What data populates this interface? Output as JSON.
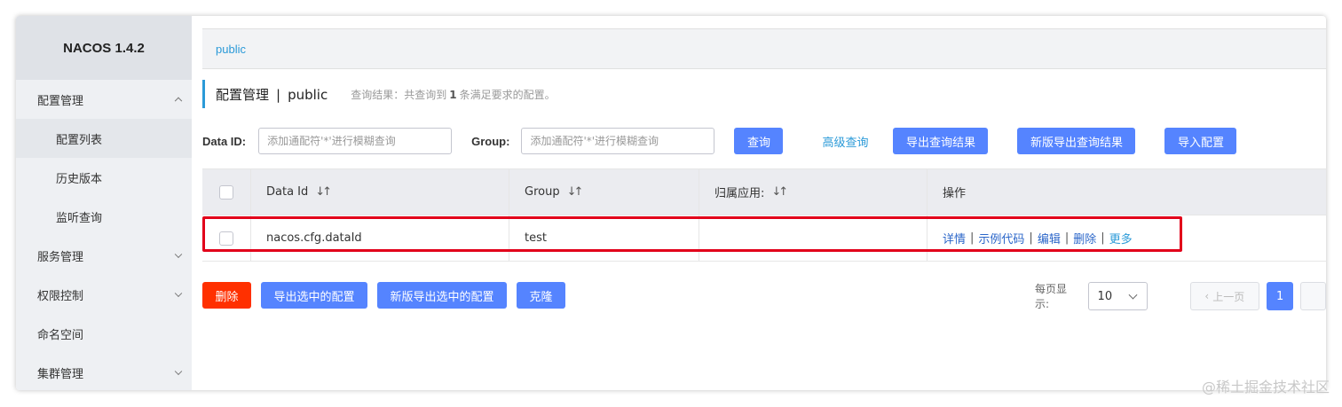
{
  "app": {
    "logo": "NACOS 1.4.2"
  },
  "sidebar": {
    "items": [
      {
        "label": "配置管理",
        "expanded": true
      },
      {
        "label": "配置列表",
        "active": true
      },
      {
        "label": "历史版本"
      },
      {
        "label": "监听查询"
      },
      {
        "label": "服务管理"
      },
      {
        "label": "权限控制"
      },
      {
        "label": "命名空间"
      },
      {
        "label": "集群管理"
      }
    ]
  },
  "namespace": {
    "link": "public"
  },
  "header": {
    "title": "配置管理",
    "separator": "|",
    "namespace": "public",
    "result_prefix": "查询结果：共查询到",
    "result_count": "1",
    "result_suffix": "条满足要求的配置。"
  },
  "filters": {
    "dataid_label": "Data ID:",
    "dataid_placeholder": "添加通配符'*'进行模糊查询",
    "group_label": "Group:",
    "group_placeholder": "添加通配符'*'进行模糊查询",
    "search_label": "查询",
    "advanced_label": "高级查询",
    "export_label": "导出查询结果",
    "export_new_label": "新版导出查询结果",
    "import_label": "导入配置"
  },
  "table": {
    "columns": [
      "Data Id",
      "Group",
      "归属应用:",
      "操作"
    ],
    "sort_icon": "↓↑",
    "rows": [
      {
        "data_id": "nacos.cfg.dataId",
        "group": "test",
        "app": ""
      }
    ],
    "ops": {
      "detail": "详情",
      "sample": "示例代码",
      "edit": "编辑",
      "delete": "删除",
      "more": "更多",
      "sep": "|"
    }
  },
  "footer": {
    "delete_label": "删除",
    "export_selected_label": "导出选中的配置",
    "export_selected_new_label": "新版导出选中的配置",
    "clone_label": "克隆"
  },
  "pager": {
    "per_page_label": "每页显示:",
    "page_size": "10",
    "prev_label": "上一页",
    "current_page": "1"
  },
  "watermark": "@稀土掘金技术社区",
  "colors": {
    "primary": "#5584ff",
    "danger": "#ff3000",
    "link": "#2b9ad8",
    "highlight": "#e2001a"
  }
}
